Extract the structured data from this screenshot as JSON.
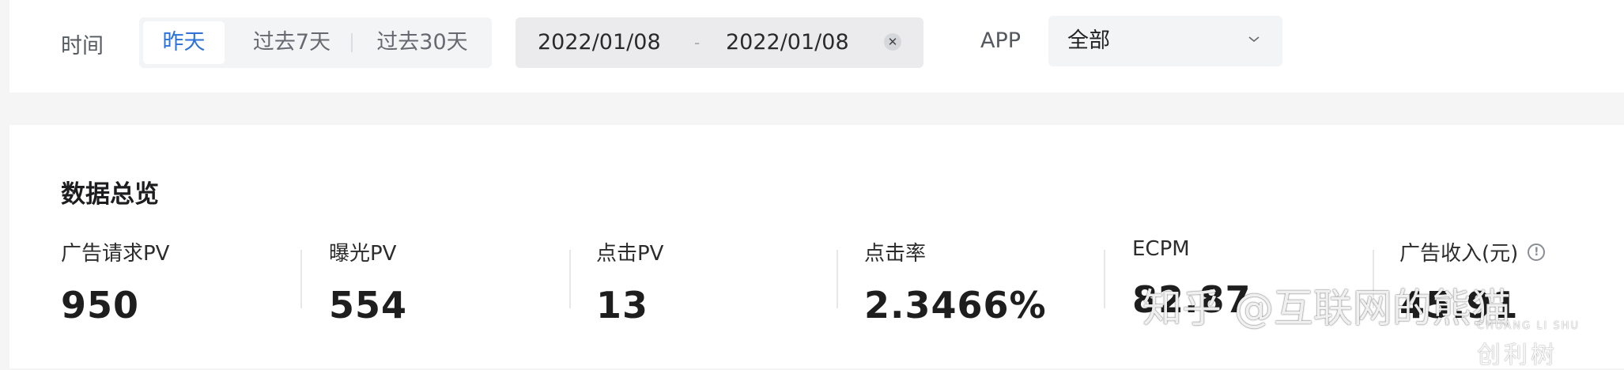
{
  "filters": {
    "time_label": "时间",
    "time_options": [
      "昨天",
      "过去7天",
      "过去30天"
    ],
    "date_start": "2022/01/08",
    "date_separator": "-",
    "date_end": "2022/01/08",
    "app_label": "APP",
    "app_value": "全部"
  },
  "overview": {
    "title": "数据总览",
    "metrics": [
      {
        "label": "广告请求PV",
        "value": "950"
      },
      {
        "label": "曝光PV",
        "value": "554"
      },
      {
        "label": "点击PV",
        "value": "13"
      },
      {
        "label": "点击率",
        "value": "2.3466%"
      },
      {
        "label": "ECPM",
        "value": "82.87"
      },
      {
        "label": "广告收入(元)",
        "value": "45.91"
      }
    ]
  },
  "watermark": {
    "text": "知乎 @互联网的熊猫",
    "logo_latin": "CHUANG LI SHU",
    "logo_cn": "创利树"
  },
  "colors": {
    "accent": "#2c72d8",
    "background": "#f5f5f6",
    "card": "#ffffff"
  }
}
